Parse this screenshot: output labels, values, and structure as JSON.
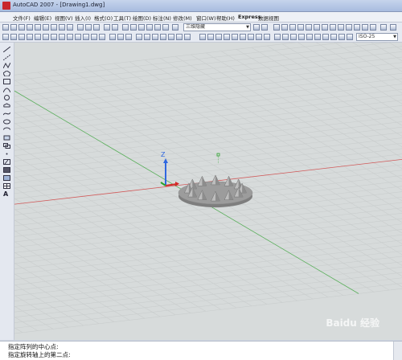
{
  "window": {
    "title": "AutoCAD 2007 - [Drawing1.dwg]"
  },
  "menu": [
    {
      "label": "文件(F)",
      "bold": false
    },
    {
      "label": "编辑(E)",
      "bold": false
    },
    {
      "label": "视图(V)",
      "bold": false
    },
    {
      "label": "插入(I)",
      "bold": false
    },
    {
      "label": "格式(O)",
      "bold": false
    },
    {
      "label": "工具(T)",
      "bold": false
    },
    {
      "label": "绘图(D)",
      "bold": false
    },
    {
      "label": "标注(N)",
      "bold": false
    },
    {
      "label": "修改(M)",
      "bold": false
    },
    {
      "label": "窗口(W)",
      "bold": false
    },
    {
      "label": "帮助(H)",
      "bold": false
    },
    {
      "label": "Express",
      "bold": true
    },
    {
      "label": "数据视图",
      "bold": false
    }
  ],
  "toolbar": {
    "visual_style": "三维隐藏",
    "dimstyle": "ISO-25"
  },
  "command_line": {
    "lines": [
      "指定阵列的中心点:",
      "指定旋转轴上的第二点:"
    ]
  },
  "watermark": "Baidu 经验",
  "colors": {
    "x_axis": "#d42a2a",
    "y_axis": "#2aa22a",
    "z_axis": "#2f67e0",
    "viewport_bg": "#d7dbdb",
    "model": "#9c9c9c"
  },
  "icons": {
    "app": "autocad-app-icon",
    "ucs": "ucs-axis-icon"
  }
}
